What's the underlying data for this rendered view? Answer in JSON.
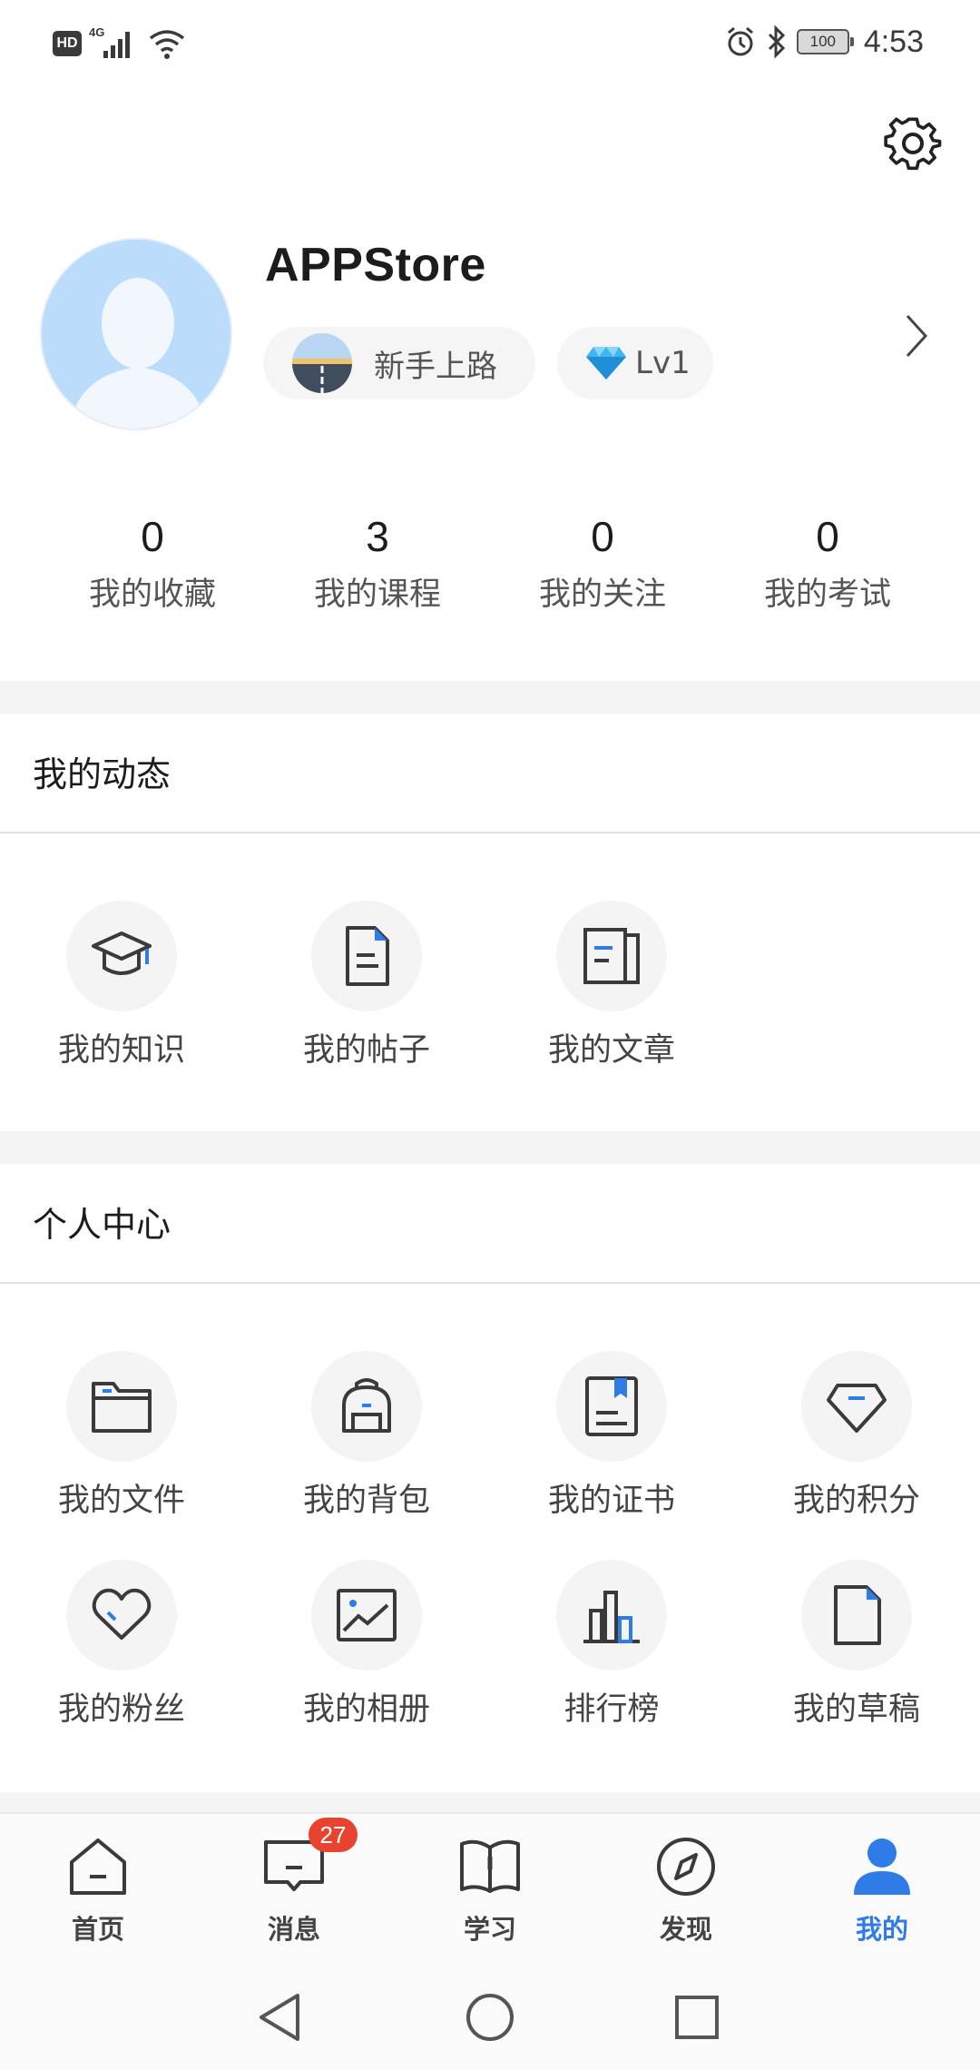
{
  "status_bar": {
    "hd": "HD",
    "network": "4G",
    "battery": "100",
    "time": "4:53"
  },
  "profile": {
    "username": "APPStore",
    "level_badge": "新手上路",
    "vip_level": "Lv1"
  },
  "stats": [
    {
      "value": "0",
      "label": "我的收藏"
    },
    {
      "value": "3",
      "label": "我的课程"
    },
    {
      "value": "0",
      "label": "我的关注"
    },
    {
      "value": "0",
      "label": "我的考试"
    }
  ],
  "dynamics": {
    "title": "我的动态",
    "items": [
      {
        "label": "我的知识",
        "icon": "graduation-cap-icon"
      },
      {
        "label": "我的帖子",
        "icon": "document-icon"
      },
      {
        "label": "我的文章",
        "icon": "article-icon"
      }
    ]
  },
  "personal": {
    "title": "个人中心",
    "items": [
      {
        "label": "我的文件",
        "icon": "folder-icon"
      },
      {
        "label": "我的背包",
        "icon": "backpack-icon"
      },
      {
        "label": "我的证书",
        "icon": "certificate-icon"
      },
      {
        "label": "我的积分",
        "icon": "diamond-icon"
      },
      {
        "label": "我的粉丝",
        "icon": "heart-icon"
      },
      {
        "label": "我的相册",
        "icon": "photo-icon"
      },
      {
        "label": "排行榜",
        "icon": "ranking-icon"
      },
      {
        "label": "我的草稿",
        "icon": "draft-icon"
      }
    ]
  },
  "bottom_nav": {
    "items": [
      {
        "label": "首页",
        "icon": "home-icon"
      },
      {
        "label": "消息",
        "icon": "message-icon",
        "badge": "27"
      },
      {
        "label": "学习",
        "icon": "book-icon"
      },
      {
        "label": "发现",
        "icon": "compass-icon"
      },
      {
        "label": "我的",
        "icon": "user-icon",
        "active": true
      }
    ]
  },
  "colors": {
    "accent": "#2f7be8",
    "badge": "#e8432f",
    "icon_stroke": "#3a3a3a",
    "section_bg": "#f4f4f4"
  }
}
